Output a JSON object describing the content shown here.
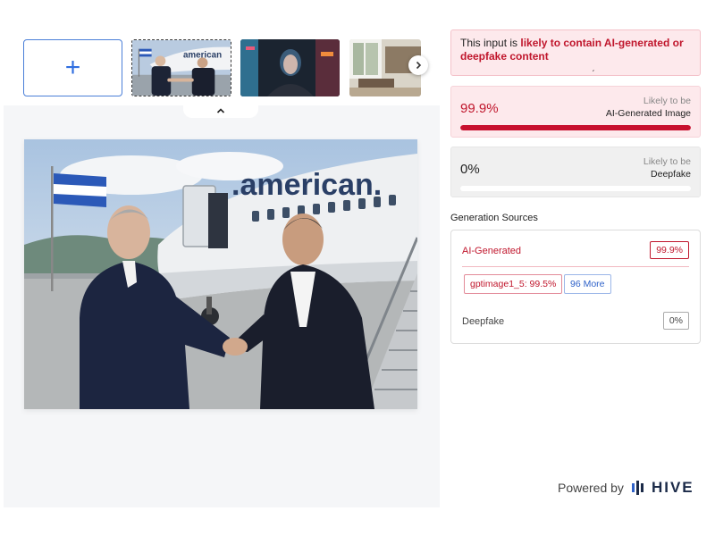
{
  "uploader": {
    "add_label": "+",
    "thumbnails": [
      {
        "name": "handshake-airport",
        "selected": true
      },
      {
        "name": "neon-portrait",
        "selected": false
      },
      {
        "name": "interior-room",
        "selected": false
      }
    ],
    "next_icon": "chevron-right-icon",
    "collapse_icon": "chevron-up-icon"
  },
  "preview": {
    "plane_text": ".american."
  },
  "result": {
    "alert_prefix": "This input is ",
    "alert_highlight": "likely to contain AI-generated or deepfake content",
    "ai_score": {
      "value": "99.9%",
      "label_line1": "Likely to be",
      "label_line2": "AI-Generated Image",
      "fill": 0.999
    },
    "deepfake_score": {
      "value": "0%",
      "label_line1": "Likely to be",
      "label_line2": "Deepfake",
      "fill": 0
    }
  },
  "sources": {
    "title": "Generation Sources",
    "ai_label": "AI-Generated",
    "ai_badge": "99.9%",
    "model_chip": "gptimage1_5: 99.5%",
    "more_chip": "96 More",
    "deepfake_label": "Deepfake",
    "deepfake_badge": "0%"
  },
  "footer": {
    "powered_by": "Powered by",
    "brand": "HIVE"
  },
  "colors": {
    "accent_red": "#c0162c",
    "accent_blue": "#2f6ee0",
    "brand_navy": "#1b2a48"
  }
}
